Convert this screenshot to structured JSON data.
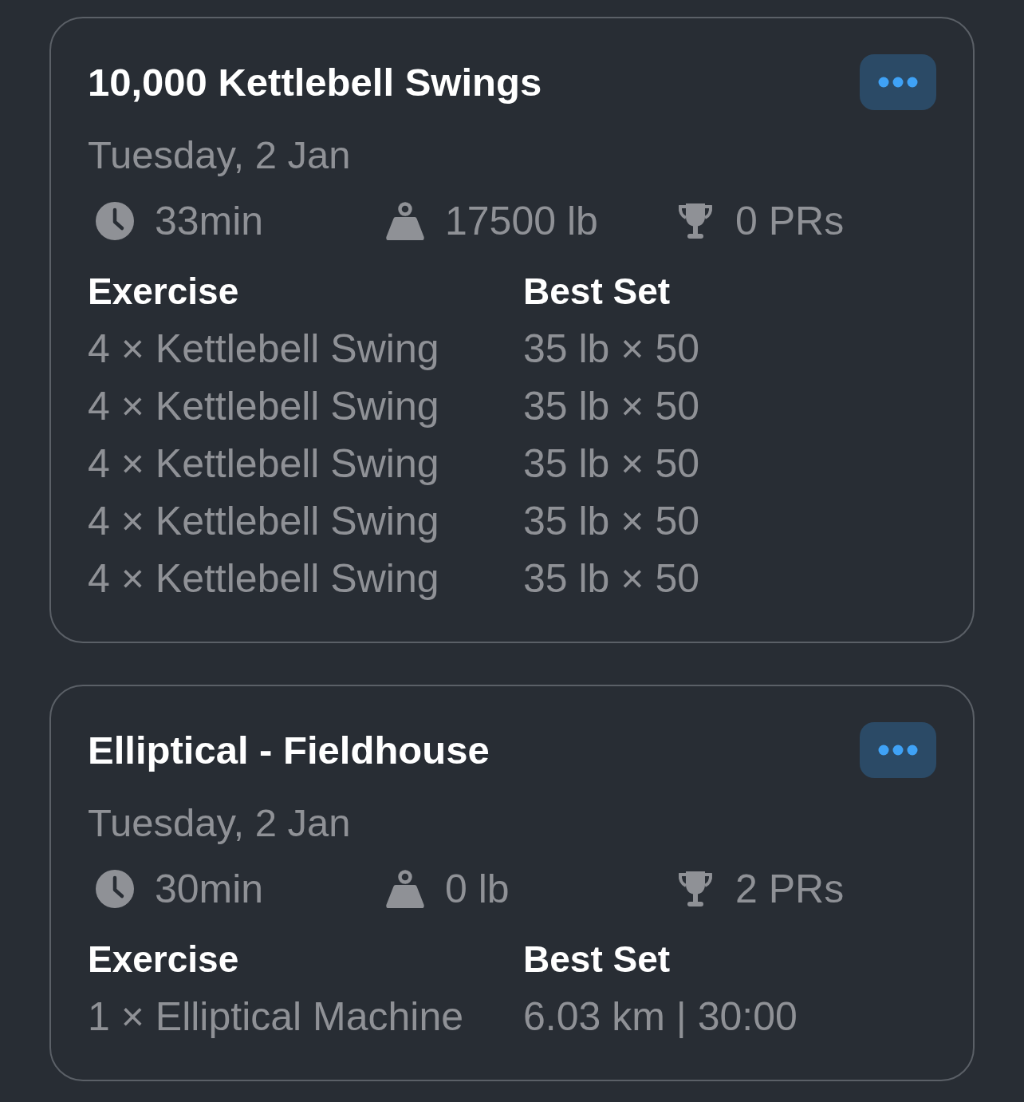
{
  "workouts": [
    {
      "title": "10,000 Kettlebell Swings",
      "date": "Tuesday, 2 Jan",
      "stats": [
        {
          "kind": "duration",
          "text": "33min"
        },
        {
          "kind": "volume",
          "text": "17500 lb"
        },
        {
          "kind": "prs",
          "text": "0 PRs"
        }
      ],
      "columns": [
        "Exercise",
        "Best Set"
      ],
      "rows": [
        {
          "exercise": "4 × Kettlebell Swing",
          "best_set": "35 lb × 50"
        },
        {
          "exercise": "4 × Kettlebell Swing",
          "best_set": "35 lb × 50"
        },
        {
          "exercise": "4 × Kettlebell Swing",
          "best_set": "35 lb × 50"
        },
        {
          "exercise": "4 × Kettlebell Swing",
          "best_set": "35 lb × 50"
        },
        {
          "exercise": "4 × Kettlebell Swing",
          "best_set": "35 lb × 50"
        }
      ]
    },
    {
      "title": "Elliptical - Fieldhouse",
      "date": "Tuesday, 2 Jan",
      "stats": [
        {
          "kind": "duration",
          "text": "30min"
        },
        {
          "kind": "volume",
          "text": "0 lb"
        },
        {
          "kind": "prs",
          "text": "2 PRs"
        }
      ],
      "columns": [
        "Exercise",
        "Best Set"
      ],
      "rows": [
        {
          "exercise": "1 × Elliptical Machine",
          "best_set": "6.03 km | 30:00"
        }
      ]
    }
  ]
}
